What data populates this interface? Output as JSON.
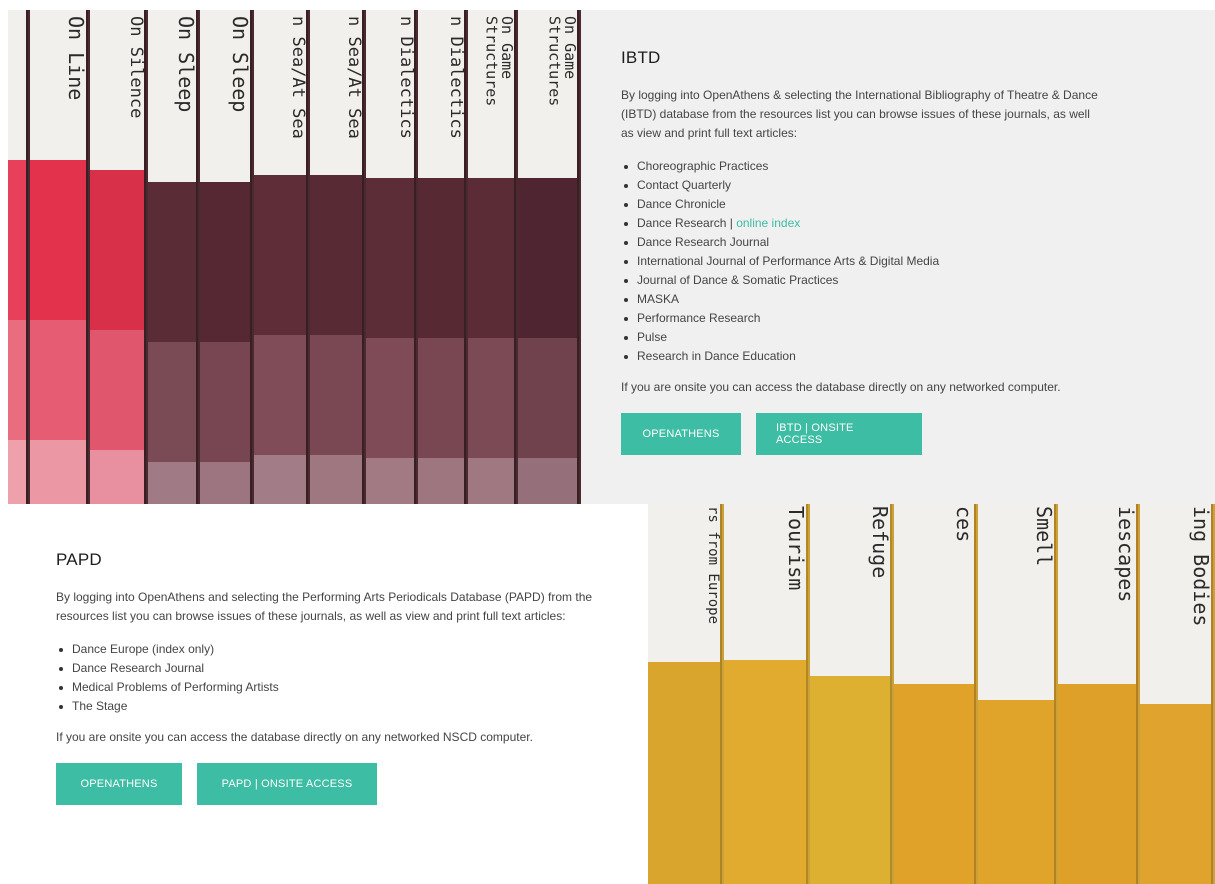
{
  "ibtd": {
    "title": "IBTD",
    "description": "By logging into OpenAthens & selecting the International Bibliography of Theatre & Dance (IBTD) database from the resources list you can browse issues of these journals, as well as view and print full text articles:",
    "journals": [
      "Choreographic Practices",
      "Contact Quarterly",
      "Dance Chronicle",
      "Dance Research",
      "Dance Research Journal",
      "International Journal of Performance Arts & Digital Media",
      "Journal of Dance & Somatic Practices",
      "MASKA",
      "Performance Research",
      "Pulse",
      "Research in Dance Education"
    ],
    "dance_research_separator": " | ",
    "online_index_link": "online index",
    "onsite_note": "If you are onsite you can access the database directly on any networked computer.",
    "button_openathens": "OPENATHENS",
    "button_onsite": "IBTD | ONSITE ACCESS"
  },
  "papd": {
    "title": "PAPD",
    "description": "By logging into OpenAthens and selecting the Performing Arts Periodicals Database (PAPD) from the resources list you can browse issues of these journals, as well as view and print full text articles:",
    "journals": [
      "Dance Europe (index only)",
      "Dance Research Journal",
      "Medical Problems of Performing Artists",
      "The Stage"
    ],
    "onsite_note": "If you are onsite you can access the database directly on any networked NSCD computer.",
    "button_openathens": "OPENATHENS",
    "button_onsite": "PAPD | ONSITE ACCESS"
  },
  "photo_top_spines": [
    "On Line",
    "On Silence",
    "On Sleep",
    "On Sleep",
    "n Sea/At Sea",
    "n Sea/At Sea",
    "n Dialectics",
    "n Dialectics",
    "On Game\nStructures",
    "On Game\nStructures"
  ],
  "photo_bottom_spines": [
    "rs from Europe",
    "Tourism",
    "Refuge",
    "ces",
    "Smell",
    "iescapes",
    "ing Bodies"
  ],
  "colors": {
    "accent": "#3dbda3",
    "panel_bg": "#f0f0f0"
  }
}
